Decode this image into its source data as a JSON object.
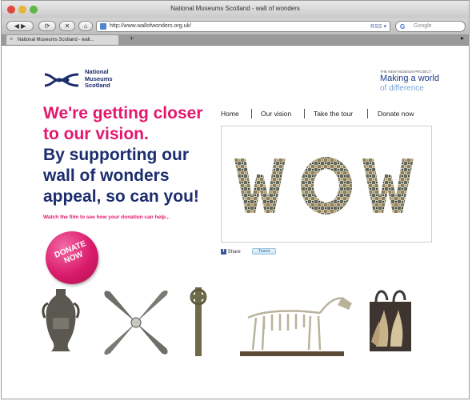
{
  "window": {
    "title": "National Museums Scotland - wall of wonders"
  },
  "toolbar": {
    "back_label": "◀ ▶",
    "reload_label": "⟳",
    "home_label": "⌂",
    "url": "http://www.wallofwonders.org.uk/",
    "search_placeholder": "Google"
  },
  "tabs": [
    {
      "label": "National Museums Scotland - wall..."
    }
  ],
  "site": {
    "logo_text": "National\nMuseums\nScotland",
    "tagline_small": "THE NEW MUSEUM PROJECT",
    "tagline_line1": "Making a world",
    "tagline_line2": "of difference",
    "headline_pink": "We're getting closer to our vision.",
    "headline_navy": "By supporting our wall of wonders appeal, so can you!",
    "film_link": "Watch the film to see how your donation can help...",
    "donate_label": "DONATE\nNOW",
    "nav": [
      "Home",
      "Our vision",
      "Take the tour",
      "Donate now"
    ],
    "share_label": "Share",
    "tweet_label": "Tweet"
  },
  "colors": {
    "pink": "#e3176c",
    "navy": "#1b2d6e"
  }
}
